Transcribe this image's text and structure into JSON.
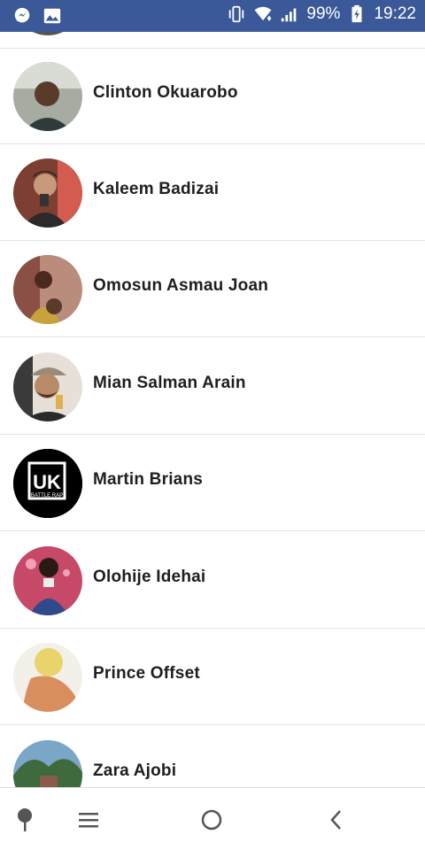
{
  "status_bar": {
    "battery_text": "99%",
    "time": "19:22",
    "icons": [
      "messenger-icon",
      "image-icon",
      "vibrate-icon",
      "wifi-icon",
      "signal-icon",
      "battery-charging-icon"
    ]
  },
  "contacts": [
    {
      "name": "Clinton Okuarobo",
      "avatar_color": "#8a8f85"
    },
    {
      "name": "Kaleem Badizai",
      "avatar_color": "#7a3b2e"
    },
    {
      "name": "Omosun Asmau Joan",
      "avatar_color": "#9a6b5a"
    },
    {
      "name": "Mian Salman Arain",
      "avatar_color": "#8c7060"
    },
    {
      "name": "Martin Brians",
      "avatar_color": "#000000",
      "avatar_text": "UK",
      "avatar_subtext": "BATTLE RAP"
    },
    {
      "name": "Olohije Idehai",
      "avatar_color": "#c9506e"
    },
    {
      "name": "Prince Offset",
      "avatar_color": "#e8a377"
    },
    {
      "name": "Zara Ajobi",
      "avatar_color": "#4e7a56"
    }
  ],
  "nav_bar": {
    "icons": [
      "pin-icon",
      "menu-icon",
      "home-circle-icon",
      "back-icon"
    ]
  }
}
